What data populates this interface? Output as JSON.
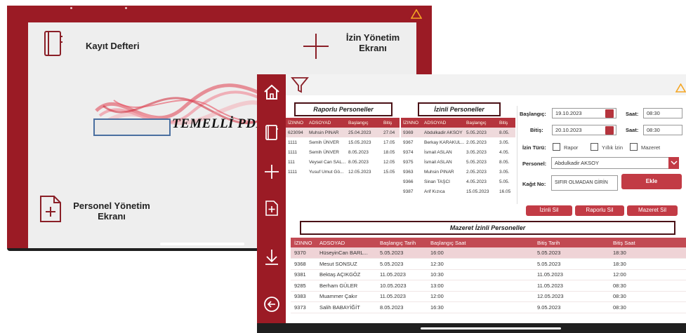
{
  "back_screen": {
    "menu": {
      "register_label": "Kayıt Defteri",
      "leave_management_label": "İzin Yönetim Ekranı",
      "personnel_management_label": "Personel Yönetim Ekranı"
    },
    "logo_text": "TEMELLİ PDKS"
  },
  "front_screen": {
    "report_title": "Raporlu Personeller",
    "leave_title": "İzinli Personeller",
    "excuse_title": "Mazeret İzinli Personeller",
    "report_table": {
      "headers": [
        "İZINNO",
        "ADSOYAD",
        "Başlangıç",
        "Bitiş"
      ],
      "rows": [
        [
          "623094",
          "Muhsin PINAR",
          "25.04.2023",
          "27.04"
        ],
        [
          "1111",
          "Semih ÜNVER",
          "15.05.2023",
          "17.05"
        ],
        [
          "1111",
          "Semih ÜNVER",
          "8.05.2023",
          "18.05"
        ],
        [
          "111",
          "Veysel Can SAL...",
          "8.05.2023",
          "12.05"
        ],
        [
          "1111",
          "Yusuf Umut Gö...",
          "12.05.2023",
          "15.05"
        ]
      ]
    },
    "leave_table": {
      "headers": [
        "İZINNO",
        "ADSOYAD",
        "Başlangıç",
        "Bitiş"
      ],
      "rows": [
        [
          "9369",
          "Abdulkadir AKSOY",
          "5.05.2023",
          "8.05."
        ],
        [
          "9367",
          "Berkay KARAKUL...",
          "2.05.2023",
          "3.05."
        ],
        [
          "9374",
          "İsmail ASLAN",
          "3.05.2023",
          "4.05."
        ],
        [
          "9375",
          "İsmail ASLAN",
          "5.05.2023",
          "8.05."
        ],
        [
          "9363",
          "Muhsin PINAR",
          "2.05.2023",
          "3.05."
        ],
        [
          "9366",
          "Sinan TAŞCI",
          "4.05.2023",
          "5.05."
        ],
        [
          "9387",
          "Arif Kızıca",
          "15.05.2023",
          "16.05"
        ]
      ]
    },
    "form": {
      "start_label": "Başlangıç:",
      "start_date": "19.10.2023",
      "start_time_label": "Saat:",
      "start_time": "08:30",
      "end_label": "Bitiş:",
      "end_date": "20.10.2023",
      "end_time_label": "Saat:",
      "end_time": "08:30",
      "type_label": "İzin Türü:",
      "type_options": [
        "Rapor",
        "Yıllık İzin",
        "Mazeret"
      ],
      "personnel_label": "Personel:",
      "personnel_value": "Abdulkadir AKSOY",
      "doc_label": "Kağıt No:",
      "doc_placeholder": "SIFIR OLMADAN GİRİN",
      "add_button": "Ekle"
    },
    "actions": {
      "delete_leave": "İzinli Sil",
      "delete_report": "Raporlu Sil",
      "delete_excuse": "Mazeret Sil"
    },
    "excuse_table": {
      "headers": [
        "İZINNO",
        "ADSOYAD",
        "Başlangıç Tarih",
        "Başlangıç Saat",
        "Bitiş Tarih",
        "Bitiş Saat"
      ],
      "rows": [
        [
          "9370",
          "HüseyinCan BARL...",
          "5.05.2023",
          "16:00",
          "5.05.2023",
          "18:30"
        ],
        [
          "9368",
          "Mesut SONSUZ",
          "5.05.2023",
          "12:30",
          "5.05.2023",
          "18:30"
        ],
        [
          "9381",
          "Bektaş AÇIKGÖZ",
          "11.05.2023",
          "10:30",
          "11.05.2023",
          "12:00"
        ],
        [
          "9285",
          "Berham GÜLER",
          "10.05.2023",
          "13:00",
          "11.05.2023",
          "08:30"
        ],
        [
          "9383",
          "Muammer Çakır",
          "11.05.2023",
          "12:00",
          "12.05.2023",
          "08:30"
        ],
        [
          "9373",
          "Salih BABAYİĞİT",
          "8.05.2023",
          "16:30",
          "9.05.2023",
          "08:30"
        ]
      ]
    }
  },
  "colors": {
    "brand": "#9b1b25",
    "header": "#c24a53",
    "accent_triangle": "#f5a623"
  }
}
